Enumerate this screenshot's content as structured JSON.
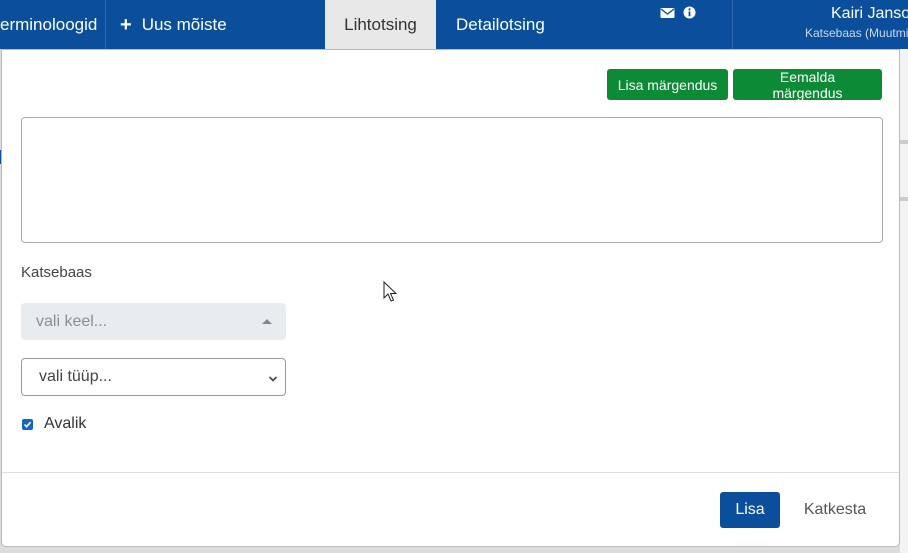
{
  "nav": {
    "terminologists": "erminoloogid",
    "new_concept": "Uus mõiste",
    "simple_search": "Lihtotsing",
    "detail_search": "Detailotsing"
  },
  "user": {
    "name": "Kairi Jansons",
    "subtitle": "Katsebaas (Muutmine)"
  },
  "modal": {
    "add_markup": "Lisa märgendus",
    "remove_markup": "Eemalda märgendus",
    "textarea_value": "",
    "dataset_label": "Katsebaas",
    "language_placeholder": "vali keel...",
    "type_placeholder": "vali tüüp...",
    "public_label": "Avalik",
    "public_checked": true,
    "submit": "Lisa",
    "cancel": "Katkesta"
  },
  "icons": {
    "mail": "envelope-icon",
    "info": "info-icon"
  },
  "colors": {
    "nav_bg": "#0b4f9c",
    "green": "#0d8a36",
    "primary": "#0b4f9c"
  }
}
